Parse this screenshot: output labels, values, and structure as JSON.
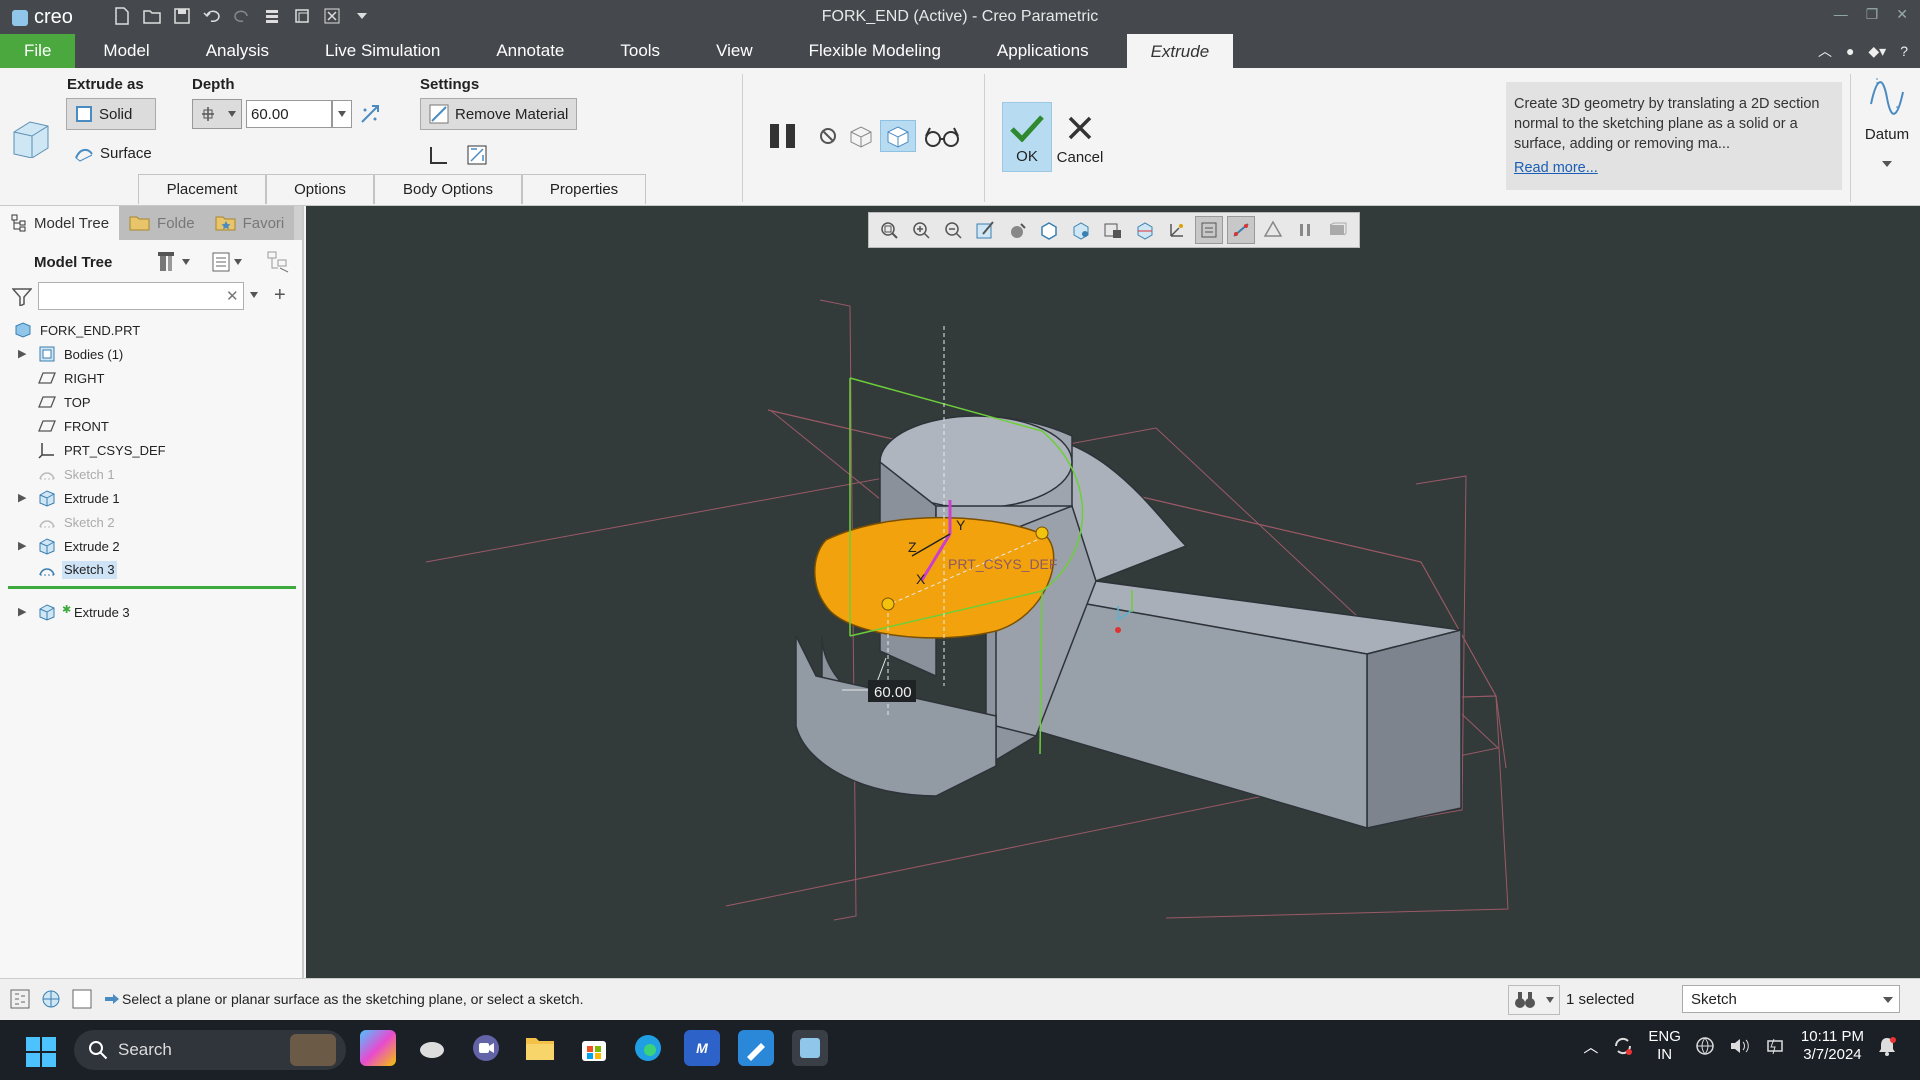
{
  "window": {
    "title": "FORK_END (Active) - Creo Parametric",
    "logo": "creo"
  },
  "tabs": {
    "file": "File",
    "model": "Model",
    "analysis": "Analysis",
    "live_simulation": "Live Simulation",
    "annotate": "Annotate",
    "tools": "Tools",
    "view": "View",
    "flexible_modeling": "Flexible Modeling",
    "applications": "Applications",
    "extrude": "Extrude"
  },
  "ribbon": {
    "extrude_as": "Extrude as",
    "solid": "Solid",
    "surface": "Surface",
    "depth": "Depth",
    "depth_value": "60.00",
    "settings": "Settings",
    "remove_material": "Remove Material",
    "ok": "OK",
    "cancel": "Cancel",
    "tip": "Create 3D geometry by translating a 2D section normal to the sketching plane as a solid or a surface, adding or removing ma...",
    "read_more": "Read more...",
    "datum": "Datum",
    "slideups": [
      "Placement",
      "Options",
      "Body Options",
      "Properties"
    ]
  },
  "navigator": {
    "tabs": [
      "Model Tree",
      "Folde",
      "Favori"
    ],
    "header": "Model Tree",
    "search_value": "",
    "items": [
      {
        "label": "FORK_END.PRT"
      },
      {
        "label": "Bodies (1)"
      },
      {
        "label": "RIGHT"
      },
      {
        "label": "TOP"
      },
      {
        "label": "FRONT"
      },
      {
        "label": "PRT_CSYS_DEF"
      },
      {
        "label": "Sketch 1"
      },
      {
        "label": "Extrude 1"
      },
      {
        "label": "Sketch 2"
      },
      {
        "label": "Extrude 2"
      },
      {
        "label": "Sketch 3"
      },
      {
        "label": "Extrude 3"
      }
    ]
  },
  "viewport": {
    "dimension_label": "60.00",
    "csys_label": "PRT_CSYS_DEF",
    "axis_labels": [
      "Y",
      "Z",
      "X"
    ],
    "model_color": "#9da4ae",
    "section_color": "#f2a20d"
  },
  "status": {
    "message": "Select a plane or planar surface as the sketching plane, or select a sketch.",
    "selected": "1 selected",
    "filter": "Sketch"
  },
  "taskbar": {
    "search": "Search",
    "lang_top": "ENG",
    "lang_bottom": "IN",
    "time": "10:11 PM",
    "date": "3/7/2024"
  }
}
